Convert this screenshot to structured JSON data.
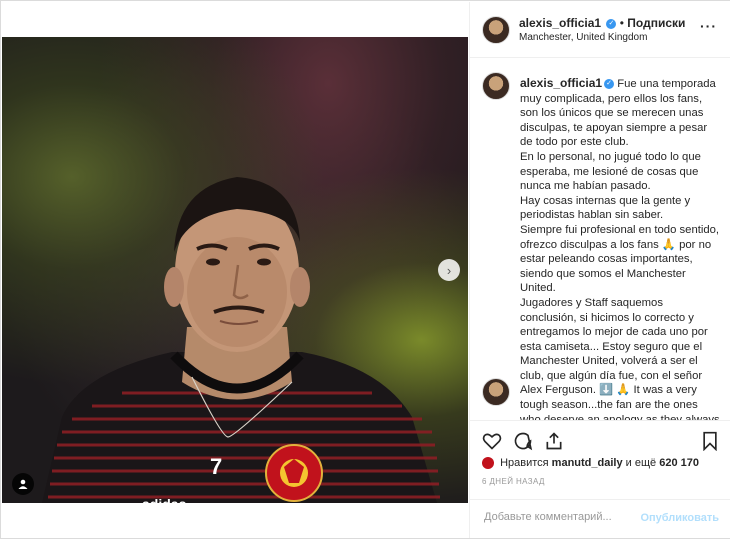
{
  "post": {
    "username": "alexis_officia1",
    "follow_label": "Подписки",
    "separator": "•",
    "location": "Manchester, United Kingdom",
    "more_icon": "more-horizontal-icon",
    "verified_icon": "verified-badge-icon"
  },
  "photo": {
    "next_icon": "chevron-right-icon",
    "tag_icon": "user-tag-icon",
    "jersey_number": "7",
    "sponsor": "adidas",
    "crest_text": "MANCHESTER UNITED"
  },
  "caption": {
    "username": "alexis_officia1",
    "text": " Fue una temporada muy complicada, pero ellos los fans, son los únicos que se merecen unas disculpas, te apoyan siempre a pesar de todo por este club.\nEn lo personal, no jugué todo lo que esperaba, me lesioné de cosas que nunca me habían pasado.\nHay cosas internas que la gente y periodistas hablan sin saber.\nSiempre fui profesional en todo sentido, ofrezco disculpas a los fans 🙏 por no estar peleando cosas importantes, siendo que somos el Manchester United.\nJugadores y Staff saquemos conclusión, si hicimos lo correcto y entregamos lo mejor de cada uno por esta camiseta... Estoy seguro que el Manchester United, volverá a ser el club, que algún día fue, con el señor Alex Ferguson. ⬇️ 🙏 It was a very tough season...the fan are the ones who deserve an apology as they always"
  },
  "actions": {
    "like_icon": "heart-icon",
    "comment_icon": "comment-icon",
    "share_icon": "share-icon",
    "save_icon": "bookmark-icon"
  },
  "likes": {
    "prefix": "Нравится",
    "user": "manutd_daily",
    "and_more": "и ещё",
    "count": "620 170"
  },
  "timestamp": "6 ДНЕЙ НАЗАД",
  "comment": {
    "placeholder": "Добавьте комментарий...",
    "publish_label": "Опубликовать"
  },
  "colors": {
    "accent": "#3897f0",
    "publish_disabled": "#b2dffc",
    "border": "#dbdbdb"
  }
}
